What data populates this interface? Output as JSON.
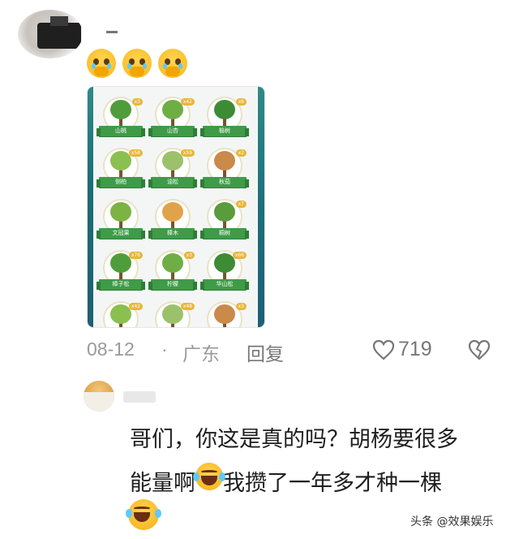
{
  "comment1": {
    "date": "08-12",
    "separator": "·",
    "region": "广东",
    "reply_label": "回复",
    "likes": "719",
    "emoji_count": 3
  },
  "screenshot": {
    "trees": [
      {
        "name": "山桃",
        "qty": "x3"
      },
      {
        "name": "山杏",
        "qty": "x42"
      },
      {
        "name": "榆树",
        "qty": "x6"
      },
      {
        "name": "侧柏",
        "qty": "x58"
      },
      {
        "name": "油松",
        "qty": "x59"
      },
      {
        "name": "秋茄",
        "qty": "x2"
      },
      {
        "name": "文冠果",
        "qty": ""
      },
      {
        "name": "樟木",
        "qty": ""
      },
      {
        "name": "桐树",
        "qty": "x7"
      },
      {
        "name": "樟子松",
        "qty": "x76"
      },
      {
        "name": "柠檬",
        "qty": "x3"
      },
      {
        "name": "华山松",
        "qty": "x66"
      },
      {
        "name": "",
        "qty": "x42"
      },
      {
        "name": "",
        "qty": "x48"
      },
      {
        "name": "",
        "qty": "x3"
      }
    ]
  },
  "comment2": {
    "line1": "哥们，你这是真的吗？胡杨要很多",
    "line2a": "能量啊",
    "line2b": "我攒了一年多才种一棵"
  },
  "watermark": "头条 @效果娱乐",
  "colors": {
    "ribbon_green": "#3f9b48",
    "meta_gray": "#9a9a9a",
    "card_edge": "#1d6f78"
  }
}
